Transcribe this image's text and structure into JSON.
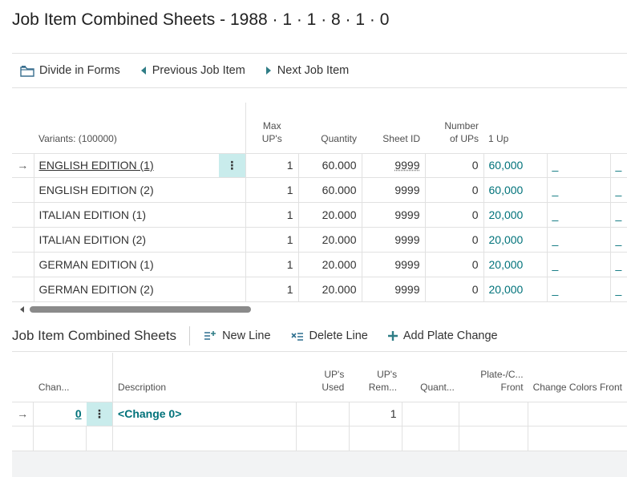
{
  "page": {
    "title": "Job Item Combined Sheets - 1988 · 1 · 1 · 8 · 1 · 0"
  },
  "toolbar": {
    "divide": "Divide in Forms",
    "previous": "Previous Job Item",
    "next": "Next Job Item"
  },
  "grid1": {
    "headers": {
      "variants": "Variants: (100000)",
      "max_ups_1": "Max",
      "max_ups_2": "UP's",
      "quantity": "Quantity",
      "sheet_id": "Sheet ID",
      "number_ups_1": "Number",
      "number_ups_2": "of UPs",
      "one_up": "1 Up"
    },
    "rows": [
      {
        "variant": "ENGLISH EDITION (1)",
        "max_ups": "1",
        "quantity": "60.000",
        "sheet_id": "9999",
        "number_ups": "0",
        "one_up": "60,000",
        "c1": "_",
        "c2": "_"
      },
      {
        "variant": "ENGLISH EDITION (2)",
        "max_ups": "1",
        "quantity": "60.000",
        "sheet_id": "9999",
        "number_ups": "0",
        "one_up": "60,000",
        "c1": "_",
        "c2": "_"
      },
      {
        "variant": "ITALIAN EDITION (1)",
        "max_ups": "1",
        "quantity": "20.000",
        "sheet_id": "9999",
        "number_ups": "0",
        "one_up": "20,000",
        "c1": "_",
        "c2": "_"
      },
      {
        "variant": "ITALIAN EDITION (2)",
        "max_ups": "1",
        "quantity": "20.000",
        "sheet_id": "9999",
        "number_ups": "0",
        "one_up": "20,000",
        "c1": "_",
        "c2": "_"
      },
      {
        "variant": "GERMAN EDITION (1)",
        "max_ups": "1",
        "quantity": "20.000",
        "sheet_id": "9999",
        "number_ups": "0",
        "one_up": "20,000",
        "c1": "_",
        "c2": "_"
      },
      {
        "variant": "GERMAN EDITION (2)",
        "max_ups": "1",
        "quantity": "20.000",
        "sheet_id": "9999",
        "number_ups": "0",
        "one_up": "20,000",
        "c1": "_",
        "c2": "_"
      }
    ]
  },
  "section2": {
    "title": "Job Item Combined Sheets",
    "new_line": "New Line",
    "delete_line": "Delete Line",
    "add_plate_change": "Add Plate Change"
  },
  "grid2": {
    "headers": {
      "change": "Chan...",
      "description": "Description",
      "ups_used_1": "UP's",
      "ups_used_2": "Used",
      "ups_rem_1": "UP's",
      "ups_rem_2": "Rem...",
      "quantity": "Quant...",
      "plate_1": "Plate-/C...",
      "plate_2": "Front",
      "change_colors": "Change Colors Front"
    },
    "rows": [
      {
        "change": "0",
        "description": "<Change 0>",
        "ups_used": "",
        "ups_rem": "1",
        "quantity": "",
        "plate": "",
        "colors": ""
      }
    ]
  },
  "colors": {
    "accent": "#00727a",
    "selected_cell": "#c9ecec",
    "border": "#e1e1e1"
  }
}
